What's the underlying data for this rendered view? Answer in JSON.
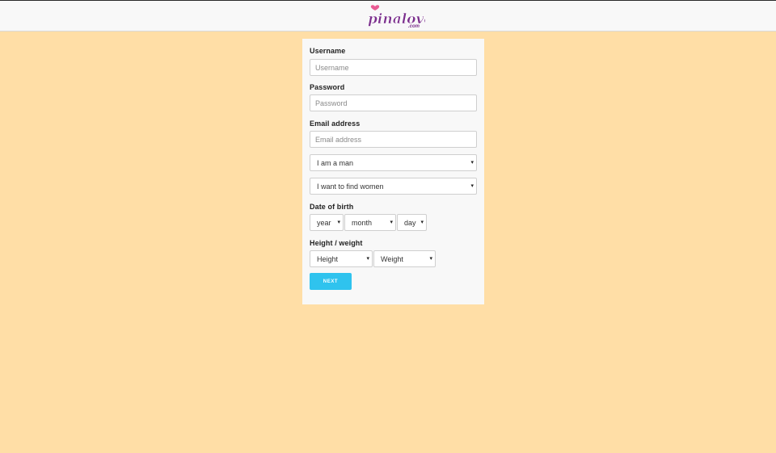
{
  "header": {
    "logo_text": "pinalove",
    "logo_suffix": ".com"
  },
  "form": {
    "username": {
      "label": "Username",
      "placeholder": "Username"
    },
    "password": {
      "label": "Password",
      "placeholder": "Password"
    },
    "email": {
      "label": "Email address",
      "placeholder": "Email address"
    },
    "gender_select": {
      "value": "I am a man"
    },
    "seeking_select": {
      "value": "I want to find women"
    },
    "dob": {
      "label": "Date of birth",
      "year": "year",
      "month": "month",
      "day": "day"
    },
    "height_weight": {
      "label": "Height / weight",
      "height": "Height",
      "weight": "Weight"
    },
    "next_label": "NEXT"
  },
  "colors": {
    "background": "#ffdea6",
    "card": "#f8f8f8",
    "accent": "#2fc3ee",
    "logo": "#7a2e8c"
  },
  "icons": {
    "select_caret": "▾"
  }
}
